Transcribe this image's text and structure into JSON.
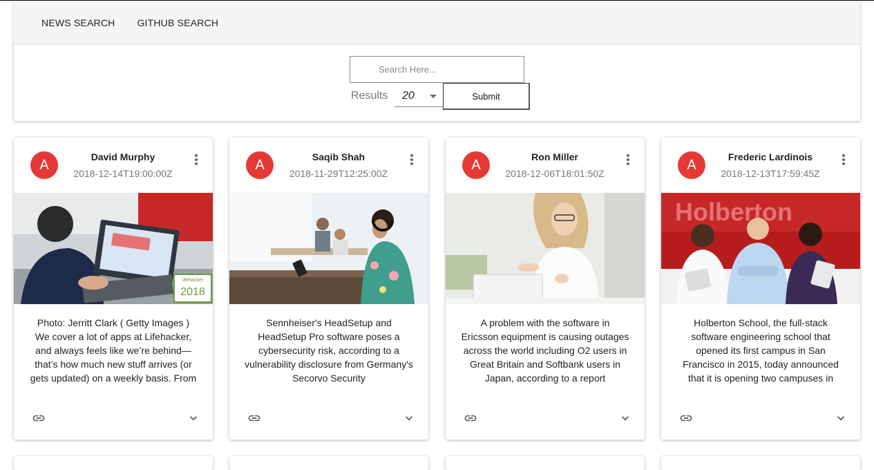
{
  "nav": {
    "news_label": "NEWS SEARCH",
    "github_label": "GITHUB SEARCH"
  },
  "search": {
    "placeholder": "Search Here...",
    "value": "",
    "results_label": "Results",
    "results_value": "20",
    "submit_label": "Submit"
  },
  "cards": [
    {
      "avatar": "A",
      "author": "David Murphy",
      "date": "2018-12-14T19:00:00Z",
      "description": "Photo: Jerritt Clark ( Getty Images ) We cover a lot of apps at Lifehacker, and always feels like we’re behind—that’s how much new stuff arrives (or gets updated) on a weekly basis. From",
      "badge_text": "lifehacker",
      "badge_year": "2018"
    },
    {
      "avatar": "A",
      "author": "Saqib Shah",
      "date": "2018-11-29T12:25:00Z",
      "description": "Sennheiser's HeadSetup and HeadSetup Pro software poses a cybersecurity risk, according to a vulnerability disclosure from Germany's Secorvo Security"
    },
    {
      "avatar": "A",
      "author": "Ron Miller",
      "date": "2018-12-06T18:01:50Z",
      "description": "A problem with the software in Ericsson equipment is causing outages across the world including O2 users in Great Britain and Softbank users in Japan, according to a report"
    },
    {
      "avatar": "A",
      "author": "Frederic Lardinois",
      "date": "2018-12-13T17:59:45Z",
      "description": "Holberton School, the full-stack software engineering school that opened its first campus in San Francisco in 2015, today announced that it is opening two campuses in",
      "sign_text": "Holberton"
    }
  ],
  "colors": {
    "avatar_bg": "#e53935",
    "appbar_bg": "#f5f5f5"
  }
}
